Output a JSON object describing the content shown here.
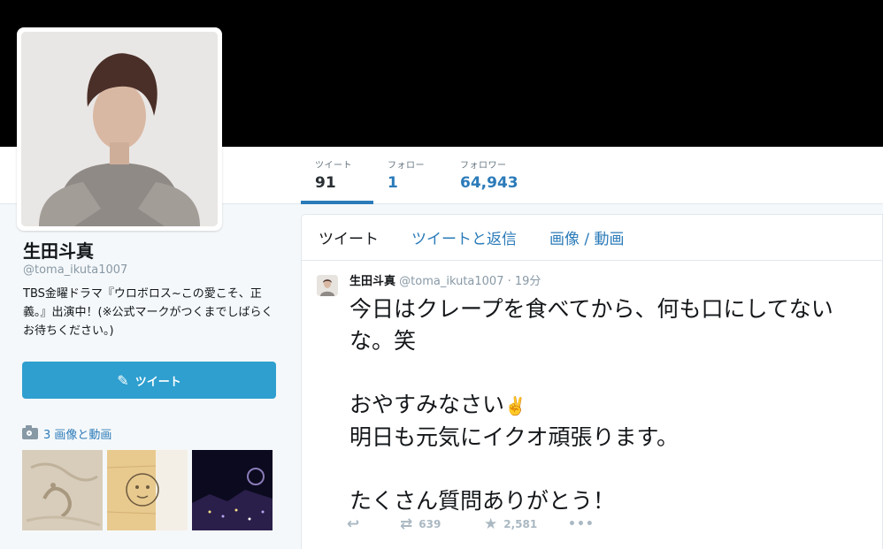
{
  "profile": {
    "name": "生田斗真",
    "handle": "@toma_ikuta1007",
    "bio": "TBS金曜ドラマ『ウロボロス~この愛こそ、正義。』出演中！(※公式マークがつくまでしばらくお待ちください。)"
  },
  "stats": [
    {
      "label": "ツイート",
      "value": "91"
    },
    {
      "label": "フォロー",
      "value": "1"
    },
    {
      "label": "フォロワー",
      "value": "64,943"
    }
  ],
  "compose": {
    "label": "ツイート",
    "icon": "quill-icon"
  },
  "media": {
    "label": "3 画像と動画",
    "icon": "camera-icon"
  },
  "timeline": {
    "tabs": [
      "ツイート",
      "ツイートと返信",
      "画像 / 動画"
    ],
    "tweet": {
      "name": "生田斗真",
      "handle": "@toma_ikuta1007",
      "time": "· 19分",
      "text_line1": "今日はクレープを食べてから、何も口にしてないな。笑",
      "text_line2": "おやすみなさい",
      "emoji": "✌️",
      "text_line3": "明日も元気にイクオ頑張ります。",
      "text_line4": "たくさん質問ありがとう！",
      "retweets": "639",
      "likes": "2,581"
    }
  },
  "colors": {
    "accent": "#2b7bb9",
    "button": "#2e9fcf",
    "banner": "#000000"
  }
}
